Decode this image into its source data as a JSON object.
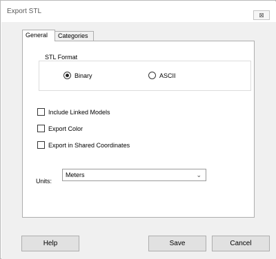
{
  "window": {
    "title": "Export STL",
    "close_glyph": "⊠"
  },
  "tabs": [
    {
      "label": "General",
      "active": true
    },
    {
      "label": "Categories",
      "active": false
    }
  ],
  "format_group": {
    "legend": "STL Format",
    "options": [
      {
        "label": "Binary",
        "selected": true
      },
      {
        "label": "ASCII",
        "selected": false
      }
    ]
  },
  "checkboxes": [
    {
      "label": "Include Linked Models",
      "checked": false
    },
    {
      "label": "Export Color",
      "checked": false
    },
    {
      "label": "Export in Shared Coordinates",
      "checked": false
    }
  ],
  "units": {
    "label": "Units:",
    "value": "Meters"
  },
  "buttons": {
    "help": "Help",
    "save": "Save",
    "cancel": "Cancel"
  }
}
